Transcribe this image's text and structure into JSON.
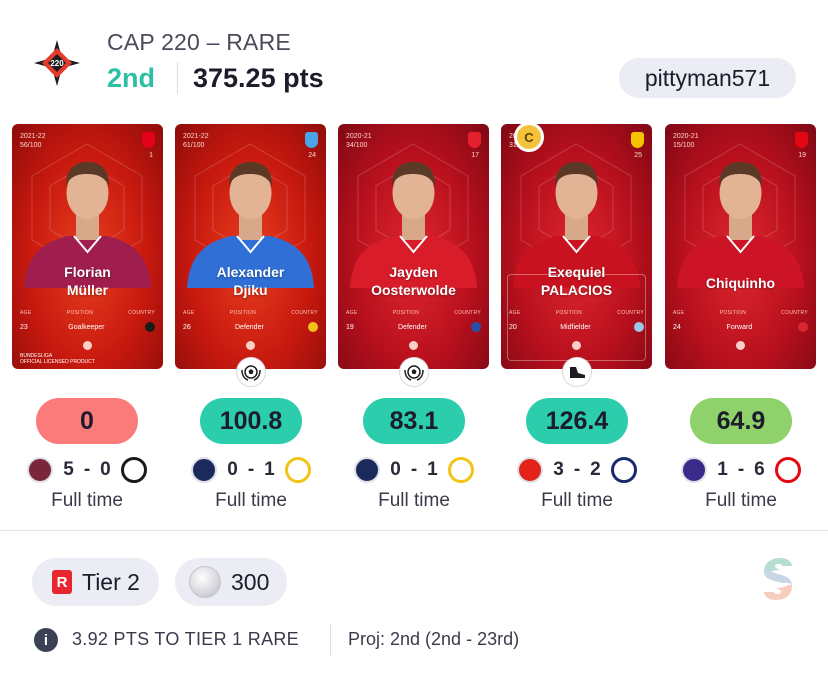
{
  "header": {
    "logo_text": "220",
    "competition_title": "CAP 220 – RARE",
    "rank": "2nd",
    "points": "375.25 pts",
    "username": "pittyman571"
  },
  "cards": [
    {
      "season": "2021-22",
      "serial": "56/100",
      "number": "1",
      "first_name": "Florian",
      "last_name": "Müller",
      "age_label": "AGE",
      "position_label": "POSITION",
      "country_label": "COUNTRY",
      "age": "23",
      "position": "Goalkeeper",
      "shirt_color": "#a01e4d",
      "crest_color": "#e2001a",
      "flag_color": "#1a1a1a",
      "sponsor": "BUNDESLIGA",
      "sponsor_sub": "OFFICIAL LICENSED PRODUCT"
    },
    {
      "season": "2021-22",
      "serial": "61/100",
      "number": "24",
      "first_name": "Alexander",
      "last_name": "Djiku",
      "age_label": "AGE",
      "position_label": "POSITION",
      "country_label": "COUNTRY",
      "age": "26",
      "position": "Defender",
      "shirt_color": "#2f6fd6",
      "crest_color": "#4aa3e6",
      "flag_color": "#f0c31a",
      "badge_icon": "soccer-ball-wreath-icon"
    },
    {
      "season": "2020-21",
      "serial": "34/100",
      "number": "17",
      "first_name": "Jayden",
      "last_name": "Oosterwolde",
      "age_label": "AGE",
      "position_label": "POSITION",
      "country_label": "COUNTRY",
      "age": "19",
      "position": "Defender",
      "shirt_color": "#d81c2a",
      "crest_color": "#e4202c",
      "flag_color": "#2a4fa8",
      "badge_icon": "soccer-ball-wreath-icon"
    },
    {
      "season": "2019",
      "serial": "31/100",
      "number": "25",
      "first_name": "Exequiel",
      "last_name": "PALACIOS",
      "age_label": "AGE",
      "position_label": "POSITION",
      "country_label": "COUNTRY",
      "age": "20",
      "position": "Midfielder",
      "shirt_color": "#c9121f",
      "crest_color": "#f5c400",
      "flag_color": "#9ec6ea",
      "captain": "C",
      "badge_icon": "football-boot-icon"
    },
    {
      "season": "2020-21",
      "serial": "15/100",
      "number": "19",
      "first_name": "",
      "last_name": "Chiquinho",
      "age_label": "AGE",
      "position_label": "POSITION",
      "country_label": "COUNTRY",
      "age": "24",
      "position": "Forward",
      "shirt_color": "#cc1426",
      "crest_color": "#e30613",
      "flag_color": "#d9262f"
    }
  ],
  "results": [
    {
      "score": "0",
      "score_bg": "#fb7a7a",
      "home_score": "5",
      "away_score": "0",
      "status": "Full time",
      "home_team_icon": "west-ham-crest-icon",
      "away_team_icon": "freiburg-crest-icon",
      "home_color": "#7a263a",
      "away_color": "#1a1a1a"
    },
    {
      "score": "100.8",
      "score_bg": "#2ccdac",
      "home_score": "0",
      "away_score": "1",
      "status": "Full time",
      "home_team_icon": "fenerbahce-crest-icon",
      "away_team_icon": "union-sg-crest-icon",
      "home_color": "#1b2a5c",
      "away_color": "#f2c418"
    },
    {
      "score": "83.1",
      "score_bg": "#2ccdac",
      "home_score": "0",
      "away_score": "1",
      "status": "Full time",
      "home_team_icon": "fenerbahce-crest-icon",
      "away_team_icon": "union-sg-crest-icon",
      "home_color": "#1b2a5c",
      "away_color": "#f2c418"
    },
    {
      "score": "126.4",
      "score_bg": "#2ccdac",
      "home_score": "3",
      "away_score": "2",
      "status": "Full time",
      "home_team_icon": "leverkusen-crest-icon",
      "away_team_icon": "arminia-crest-icon",
      "home_color": "#e32219",
      "away_color": "#1a2a6c"
    },
    {
      "score": "64.9",
      "score_bg": "#8fd16a",
      "home_score": "1",
      "away_score": "6",
      "status": "Full time",
      "home_team_icon": "club-crest-purple-icon",
      "away_team_icon": "benfica-crest-icon",
      "home_color": "#3a2a8a",
      "away_color": "#e30613"
    }
  ],
  "footer": {
    "tier_letter": "R",
    "tier_label": "Tier 2",
    "coins": "300",
    "tier_info": "3.92 PTS TO TIER 1 RARE",
    "projection": "Proj: 2nd (2nd - 23rd)",
    "info_icon": "i"
  }
}
